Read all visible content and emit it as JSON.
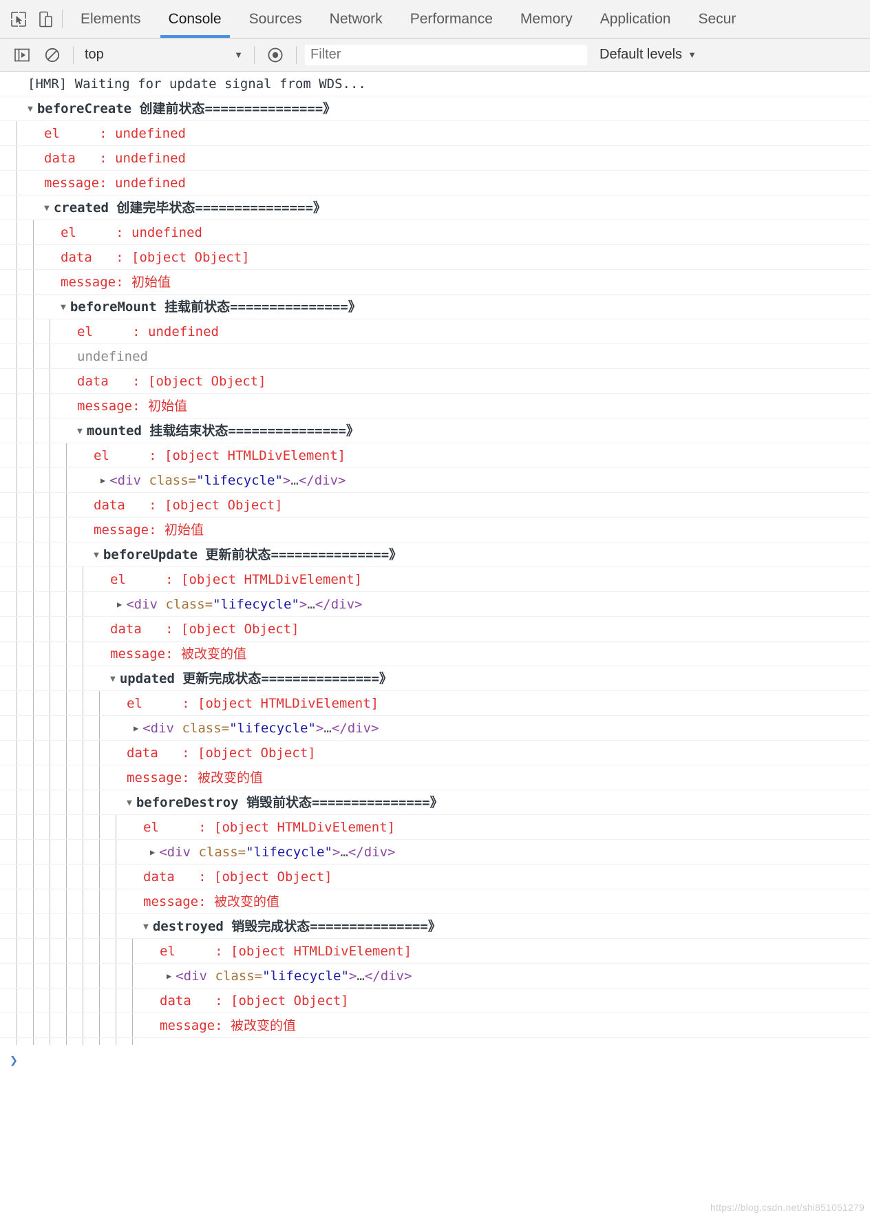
{
  "devtools": {
    "icons": [
      {
        "name": "inspect-element-icon",
        "glyph": "inspect"
      },
      {
        "name": "device-toolbar-icon",
        "glyph": "device"
      }
    ],
    "tabs": [
      {
        "label": "Elements",
        "selected": false
      },
      {
        "label": "Console",
        "selected": true
      },
      {
        "label": "Sources",
        "selected": false
      },
      {
        "label": "Network",
        "selected": false
      },
      {
        "label": "Performance",
        "selected": false
      },
      {
        "label": "Memory",
        "selected": false
      },
      {
        "label": "Application",
        "selected": false
      },
      {
        "label": "Secur",
        "selected": false
      }
    ]
  },
  "console_toolbar": {
    "execute_icon": "execution-context-icon",
    "clear_icon": "clear-console-icon",
    "context_value": "top",
    "context_caret": "▼",
    "eye_icon": "live-expression-icon",
    "filter_placeholder": "Filter",
    "filter_value": "",
    "levels_label": "Default levels",
    "levels_caret": "▼"
  },
  "accent": "#4a90e2",
  "colors": {
    "red": "#e03232",
    "grey": "#8a8a8a",
    "tag": "#8c49a3",
    "attr_name": "#a6733a",
    "attr_value": "#1a1aa6",
    "header": "#303942"
  },
  "log": {
    "hmr_message": "[HMR] Waiting for update signal from WDS...",
    "groups": [
      {
        "name": "beforeCreate",
        "label": "创建前状态===============》",
        "arrow": "▼",
        "depth": 0,
        "lines": [
          {
            "type": "kv",
            "key": "el",
            "pad": 5,
            "value": "undefined",
            "color": "red"
          },
          {
            "type": "kv",
            "key": "data",
            "pad": 3,
            "value": "undefined",
            "color": "red"
          },
          {
            "type": "kv",
            "key": "message",
            "pad": 0,
            "value": "undefined",
            "color": "red",
            "nospace": true
          }
        ]
      },
      {
        "name": "created",
        "label": "创建完毕状态===============》",
        "arrow": "▼",
        "depth": 1,
        "lines": [
          {
            "type": "kv",
            "key": "el",
            "pad": 5,
            "value": "undefined",
            "color": "red"
          },
          {
            "type": "kv",
            "key": "data",
            "pad": 3,
            "value": "[object Object]",
            "color": "red"
          },
          {
            "type": "kv",
            "key": "message",
            "pad": 0,
            "value": "初始值",
            "color": "red",
            "nospace": true
          }
        ]
      },
      {
        "name": "beforeMount",
        "label": "挂载前状态===============》",
        "arrow": "▼",
        "depth": 2,
        "lines": [
          {
            "type": "kv",
            "key": "el",
            "pad": 5,
            "value": "undefined",
            "color": "red"
          },
          {
            "type": "plain",
            "value": "undefined",
            "color": "grey"
          },
          {
            "type": "kv",
            "key": "data",
            "pad": 3,
            "value": "[object Object]",
            "color": "red"
          },
          {
            "type": "kv",
            "key": "message",
            "pad": 0,
            "value": "初始值",
            "color": "red",
            "nospace": true
          }
        ]
      },
      {
        "name": "mounted",
        "label": "挂载结束状态===============》",
        "arrow": "▼",
        "depth": 3,
        "lines": [
          {
            "type": "kv",
            "key": "el",
            "pad": 5,
            "value": "[object HTMLDivElement]",
            "color": "red"
          },
          {
            "type": "dom",
            "arrow": "▶",
            "open_tag": "<div ",
            "attr": "class=",
            "attr_value": "\"lifecycle\"",
            "gt": ">",
            "ellipsis": "…",
            "close_tag": "</div>"
          },
          {
            "type": "kv",
            "key": "data",
            "pad": 3,
            "value": "[object Object]",
            "color": "red"
          },
          {
            "type": "kv",
            "key": "message",
            "pad": 0,
            "value": "初始值",
            "color": "red",
            "nospace": true
          }
        ]
      },
      {
        "name": "beforeUpdate",
        "label": "更新前状态===============》",
        "arrow": "▼",
        "depth": 4,
        "lines": [
          {
            "type": "kv",
            "key": "el",
            "pad": 5,
            "value": "[object HTMLDivElement]",
            "color": "red"
          },
          {
            "type": "dom",
            "arrow": "▶",
            "open_tag": "<div ",
            "attr": "class=",
            "attr_value": "\"lifecycle\"",
            "gt": ">",
            "ellipsis": "…",
            "close_tag": "</div>"
          },
          {
            "type": "kv",
            "key": "data",
            "pad": 3,
            "value": "[object Object]",
            "color": "red"
          },
          {
            "type": "kv",
            "key": "message",
            "pad": 0,
            "value": "被改变的值",
            "color": "red",
            "nospace": true
          }
        ]
      },
      {
        "name": "updated",
        "label": "更新完成状态===============》",
        "arrow": "▼",
        "depth": 5,
        "lines": [
          {
            "type": "kv",
            "key": "el",
            "pad": 5,
            "value": "[object HTMLDivElement]",
            "color": "red"
          },
          {
            "type": "dom",
            "arrow": "▶",
            "open_tag": "<div ",
            "attr": "class=",
            "attr_value": "\"lifecycle\"",
            "gt": ">",
            "ellipsis": "…",
            "close_tag": "</div>"
          },
          {
            "type": "kv",
            "key": "data",
            "pad": 3,
            "value": "[object Object]",
            "color": "red"
          },
          {
            "type": "kv",
            "key": "message",
            "pad": 0,
            "value": "被改变的值",
            "color": "red",
            "nospace": true
          }
        ]
      },
      {
        "name": "beforeDestroy",
        "label": "销毁前状态===============》",
        "arrow": "▼",
        "depth": 6,
        "lines": [
          {
            "type": "kv",
            "key": "el",
            "pad": 5,
            "value": "[object HTMLDivElement]",
            "color": "red"
          },
          {
            "type": "dom",
            "arrow": "▶",
            "open_tag": "<div ",
            "attr": "class=",
            "attr_value": "\"lifecycle\"",
            "gt": ">",
            "ellipsis": "…",
            "close_tag": "</div>"
          },
          {
            "type": "kv",
            "key": "data",
            "pad": 3,
            "value": "[object Object]",
            "color": "red"
          },
          {
            "type": "kv",
            "key": "message",
            "pad": 0,
            "value": "被改变的值",
            "color": "red",
            "nospace": true
          }
        ]
      },
      {
        "name": "destroyed",
        "label": "销毁完成状态===============》",
        "arrow": "▼",
        "depth": 7,
        "lines": [
          {
            "type": "kv",
            "key": "el",
            "pad": 5,
            "value": "[object HTMLDivElement]",
            "color": "red"
          },
          {
            "type": "dom",
            "arrow": "▶",
            "open_tag": "<div ",
            "attr": "class=",
            "attr_value": "\"lifecycle\"",
            "gt": ">",
            "ellipsis": "…",
            "close_tag": "</div>"
          },
          {
            "type": "kv",
            "key": "data",
            "pad": 3,
            "value": "[object Object]",
            "color": "red"
          },
          {
            "type": "kv",
            "key": "message",
            "pad": 0,
            "value": "被改变的值",
            "color": "red",
            "nospace": true
          }
        ]
      }
    ]
  },
  "prompt": {
    "caret": "❯"
  },
  "watermark": "https://blog.csdn.net/shi851051279"
}
